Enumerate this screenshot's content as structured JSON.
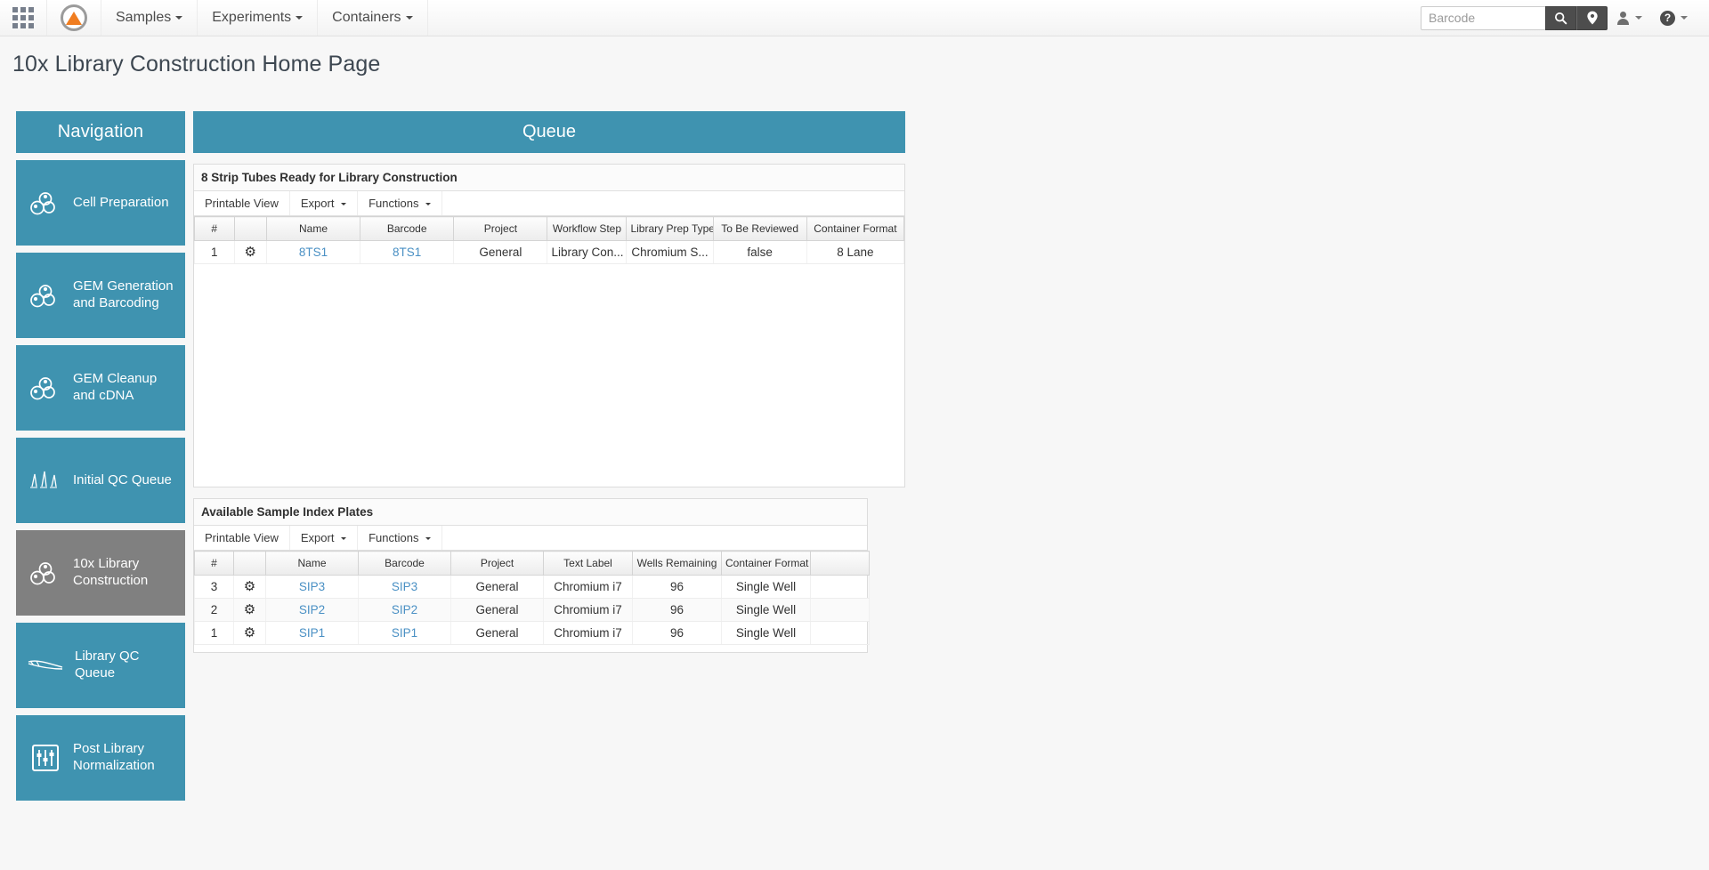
{
  "navbar": {
    "apps_icon": "grid-apps-icon",
    "logo_icon": "app-logo-icon",
    "menus": [
      {
        "label": "Samples"
      },
      {
        "label": "Experiments"
      },
      {
        "label": "Containers"
      }
    ],
    "search": {
      "placeholder": "Barcode",
      "value": "",
      "search_icon": "search-icon",
      "location_icon": "location-pin-icon"
    },
    "user_icon": "user-icon",
    "help_icon": "help-icon"
  },
  "page": {
    "title": "10x Library Construction Home Page"
  },
  "sidebar": {
    "header": "Navigation",
    "items": [
      {
        "label": "Cell Preparation",
        "icon": "cells-icon",
        "active": false
      },
      {
        "label": "GEM Generation and Barcoding",
        "icon": "cells-icon",
        "active": false
      },
      {
        "label": "GEM Cleanup and cDNA",
        "icon": "cells-icon",
        "active": false
      },
      {
        "label": "Initial QC Queue",
        "icon": "electropherogram-icon",
        "active": false
      },
      {
        "label": "10x Library Construction",
        "icon": "cells-icon",
        "active": true
      },
      {
        "label": "Library QC Queue",
        "icon": "dna-strand-icon",
        "active": false
      },
      {
        "label": "Post Library Normalization",
        "icon": "sliders-icon",
        "active": false
      }
    ]
  },
  "queue": {
    "header": "Queue",
    "sections": [
      {
        "title": "8 Strip Tubes Ready for Library Construction",
        "toolbar": [
          {
            "label": "Printable View",
            "has_caret": false
          },
          {
            "label": "Export",
            "has_caret": true
          },
          {
            "label": "Functions",
            "has_caret": true
          }
        ],
        "columns": [
          "#",
          "",
          "Name",
          "Barcode",
          "Project",
          "Workflow Step",
          "Library Prep Type",
          "To Be Reviewed",
          "Container Format"
        ],
        "rows": [
          {
            "index": "1",
            "gear": "gear-icon",
            "name": "8TS1",
            "barcode": "8TS1",
            "project": "General",
            "workflow_step": "Library Con...",
            "library_prep_type": "Chromium S...",
            "to_be_reviewed": "false",
            "container_format": "8 Lane"
          }
        ]
      },
      {
        "title": "Available Sample Index Plates",
        "toolbar": [
          {
            "label": "Printable View",
            "has_caret": false
          },
          {
            "label": "Export",
            "has_caret": true
          },
          {
            "label": "Functions",
            "has_caret": true
          }
        ],
        "columns": [
          "#",
          "",
          "Name",
          "Barcode",
          "Project",
          "Text Label",
          "Wells Remaining",
          "Container Format",
          ""
        ],
        "rows": [
          {
            "index": "3",
            "gear": "gear-icon",
            "name": "SIP3",
            "barcode": "SIP3",
            "project": "General",
            "text_label": "Chromium i7",
            "wells_remaining": "96",
            "container_format": "Single Well"
          },
          {
            "index": "2",
            "gear": "gear-icon",
            "name": "SIP2",
            "barcode": "SIP2",
            "project": "General",
            "text_label": "Chromium i7",
            "wells_remaining": "96",
            "container_format": "Single Well"
          },
          {
            "index": "1",
            "gear": "gear-icon",
            "name": "SIP1",
            "barcode": "SIP1",
            "project": "General",
            "text_label": "Chromium i7",
            "wells_remaining": "96",
            "container_format": "Single Well"
          }
        ]
      }
    ]
  },
  "colors": {
    "accent_teal": "#3f93b0",
    "active_gray": "#808080",
    "link_blue": "#4a90c4",
    "logo_orange": "#f07d20",
    "page_bg": "#f7f7f7"
  }
}
